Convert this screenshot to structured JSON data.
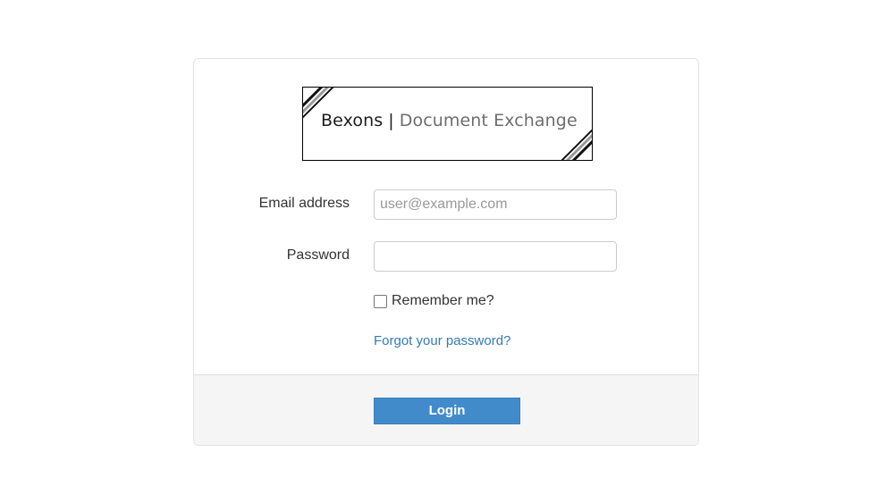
{
  "logo": {
    "brand": "Bexons",
    "separator": "|",
    "product": "Document Exchange"
  },
  "form": {
    "email_label": "Email address",
    "email_placeholder": "user@example.com",
    "email_value": "",
    "password_label": "Password",
    "password_value": "",
    "remember_label": "Remember me?",
    "remember_checked": false,
    "forgot_link": "Forgot your password?"
  },
  "footer": {
    "login_label": "Login"
  },
  "colors": {
    "link": "#337ab7",
    "button": "#428bca",
    "footer_bg": "#f5f5f5"
  }
}
